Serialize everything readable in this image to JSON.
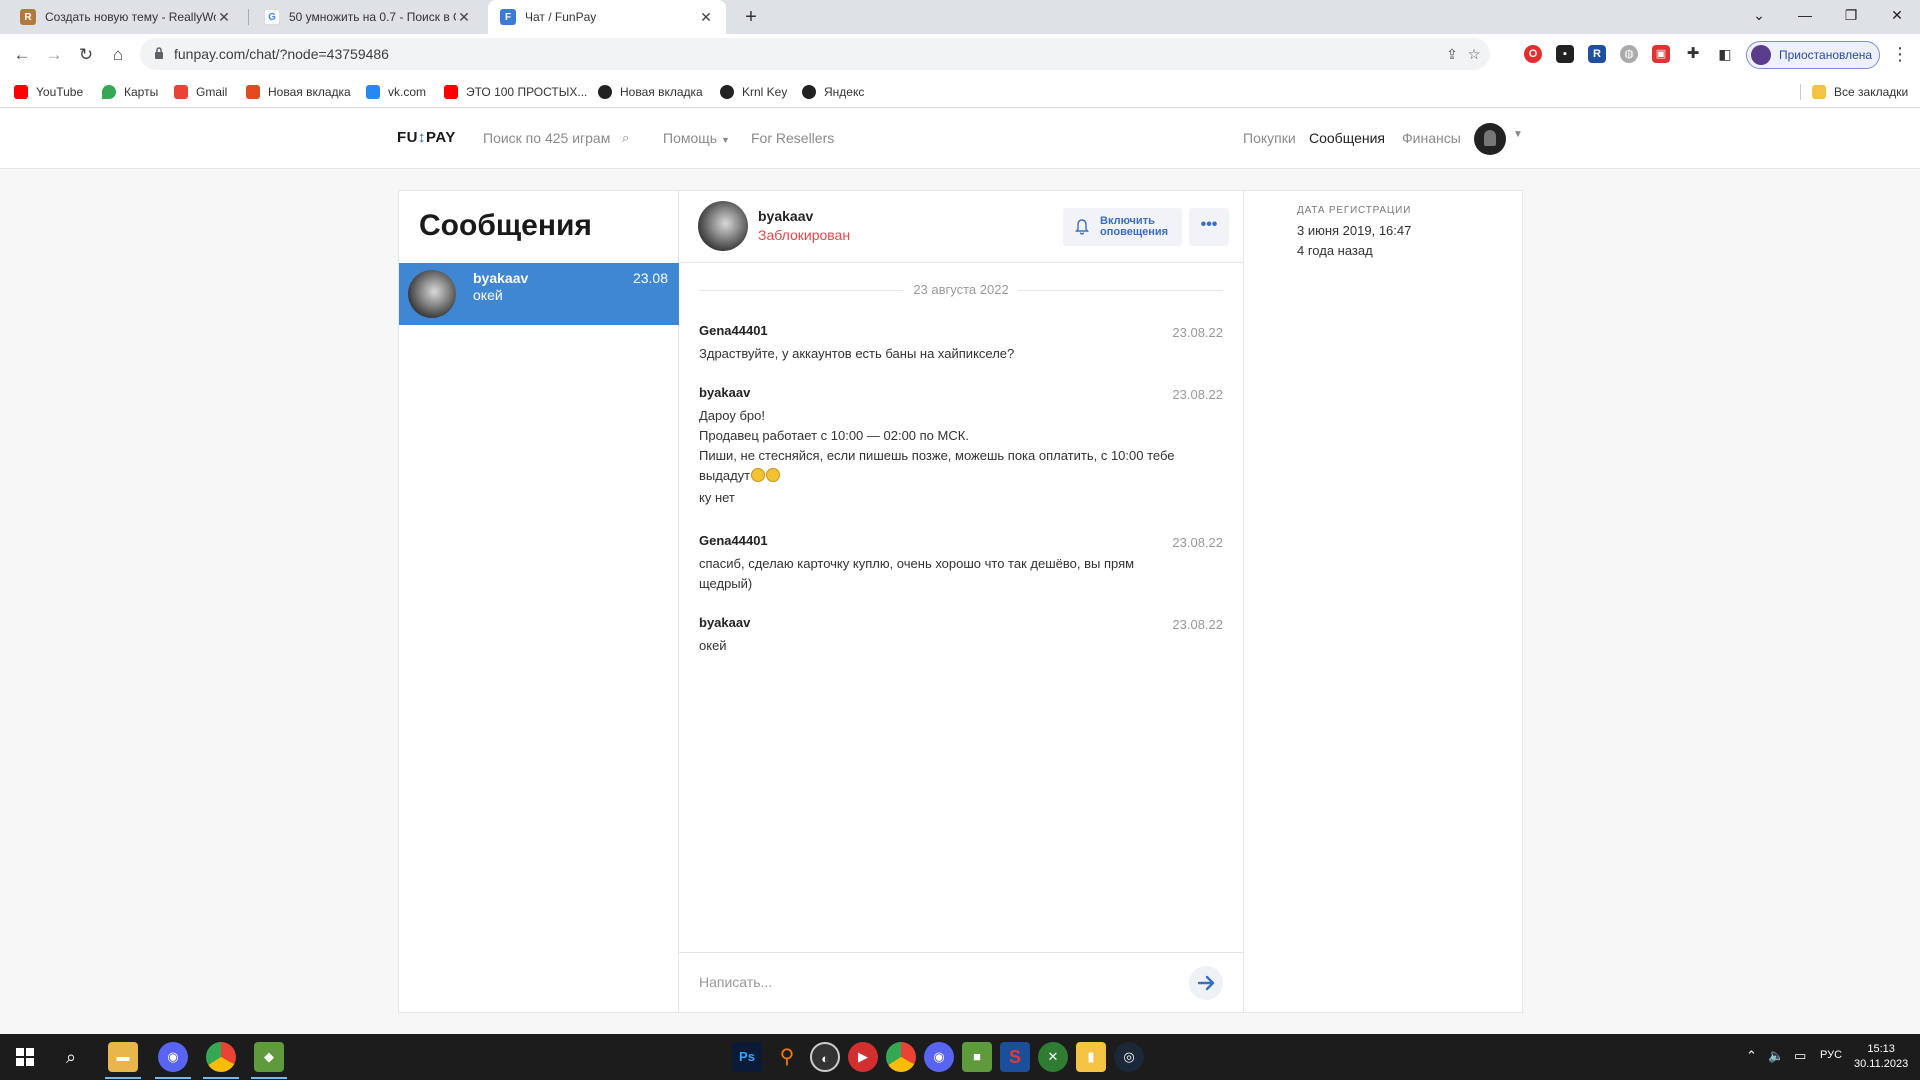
{
  "browser": {
    "tabs": [
      {
        "title": "Создать новую тему - ReallyWo",
        "active": false
      },
      {
        "title": "50 умножить на 0.7 - Поиск в G",
        "active": false
      },
      {
        "title": "Чат / FunPay",
        "active": true
      }
    ],
    "url": "funpay.com/chat/?node=43759486",
    "profile_label": "Приостановлена",
    "bookmarks": [
      "YouTube",
      "Карты",
      "Gmail",
      "Новая вкладка",
      "vk.com",
      "ЭТО 100 ПРОСТЫХ...",
      "Новая вкладка",
      "Krnl Key",
      "Яндекс"
    ],
    "all_bookmarks": "Все закладки"
  },
  "site": {
    "logo": "FUNPAY",
    "search_placeholder": "Поиск по 425 играм",
    "nav": {
      "help": "Помощь",
      "resellers": "For Resellers",
      "purchases": "Покупки",
      "messages": "Сообщения",
      "finances": "Финансы"
    }
  },
  "contacts": {
    "title": "Сообщения",
    "items": [
      {
        "name": "byakaav",
        "last_message": "окей",
        "date": "23.08"
      }
    ]
  },
  "chat": {
    "partner_name": "byakaav",
    "partner_status": "Заблокирован",
    "notify_label_1": "Включить",
    "notify_label_2": "оповещения",
    "more_label": "•••",
    "date_divider": "23 августа 2022",
    "messages": [
      {
        "author": "Gena44401",
        "date": "23.08.22",
        "lines": [
          "Здраствуйте, у аккаунтов есть баны на хайпикселе?"
        ]
      },
      {
        "author": "byakaav",
        "date": "23.08.22",
        "lines": [
          "Дароу бро!",
          "Продавец работает с 10:00 — 02:00 по МСК.",
          "Пиши, не стесняйся, если пишешь позже, можешь пока оплатить, с 10:00 тебе",
          "выдадут",
          "ку нет"
        ]
      },
      {
        "author": "Gena44401",
        "date": "23.08.22",
        "lines": [
          "спасиб, сделаю карточку куплю, очень хорошо что так дешёво, вы прям",
          "щедрый)"
        ]
      },
      {
        "author": "byakaav",
        "date": "23.08.22",
        "lines": [
          "окей"
        ]
      }
    ],
    "composer_placeholder": "Написать..."
  },
  "info": {
    "reg_label": "ДАТА РЕГИСТРАЦИИ",
    "reg_date": "3 июня 2019, 16:47",
    "reg_ago": "4 года назад"
  },
  "taskbar": {
    "lang": "РУС",
    "time": "15:13",
    "date": "30.11.2023"
  },
  "colors": {
    "accent_blue": "#3f86d3",
    "blocked_red": "#e54848",
    "link_blue": "#3a6fc4"
  }
}
